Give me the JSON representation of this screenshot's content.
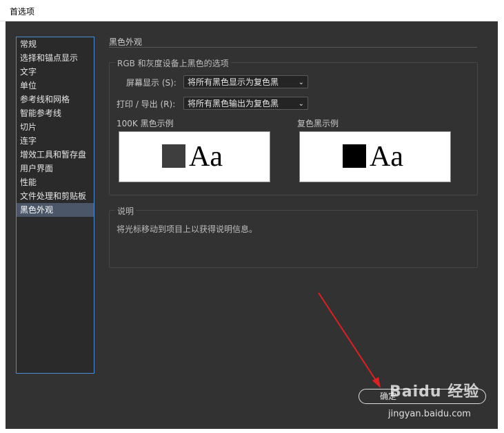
{
  "window": {
    "title": "首选项"
  },
  "sidebar": {
    "items": [
      {
        "label": "常规"
      },
      {
        "label": "选择和锚点显示"
      },
      {
        "label": "文字"
      },
      {
        "label": "单位"
      },
      {
        "label": "参考线和网格"
      },
      {
        "label": "智能参考线"
      },
      {
        "label": "切片"
      },
      {
        "label": "连字"
      },
      {
        "label": "增效工具和暂存盘"
      },
      {
        "label": "用户界面"
      },
      {
        "label": "性能"
      },
      {
        "label": "文件处理和剪贴板"
      },
      {
        "label": "黑色外观"
      }
    ],
    "selected": "黑色外观"
  },
  "main": {
    "section_title": "黑色外观",
    "options_group": {
      "legend": "RGB 和灰度设备上黑色的选项",
      "screen_label": "屏幕显示 (S):",
      "screen_value": "将所有黑色显示为复色黑",
      "print_label": "打印 / 导出 (R):",
      "print_value": "将所有黑色输出为复色黑",
      "preview_100k_label": "100K 黑色示例",
      "preview_rich_label": "复色黑示例",
      "preview_text": "Aa",
      "swatch_100k_color": "#3e3e3e",
      "swatch_rich_color": "#000000"
    },
    "description_group": {
      "legend": "说明",
      "text": "将光标移动到项目上以获得说明信息。"
    }
  },
  "footer": {
    "ok_label": "确定"
  },
  "watermark": {
    "logo": "Baidu 经验",
    "url": "jingyan.baidu.com"
  },
  "colors": {
    "dialog_bg": "#323232",
    "selection": "#4b5668",
    "focus_border": "#4a90d9",
    "arrow": "#e02020"
  }
}
